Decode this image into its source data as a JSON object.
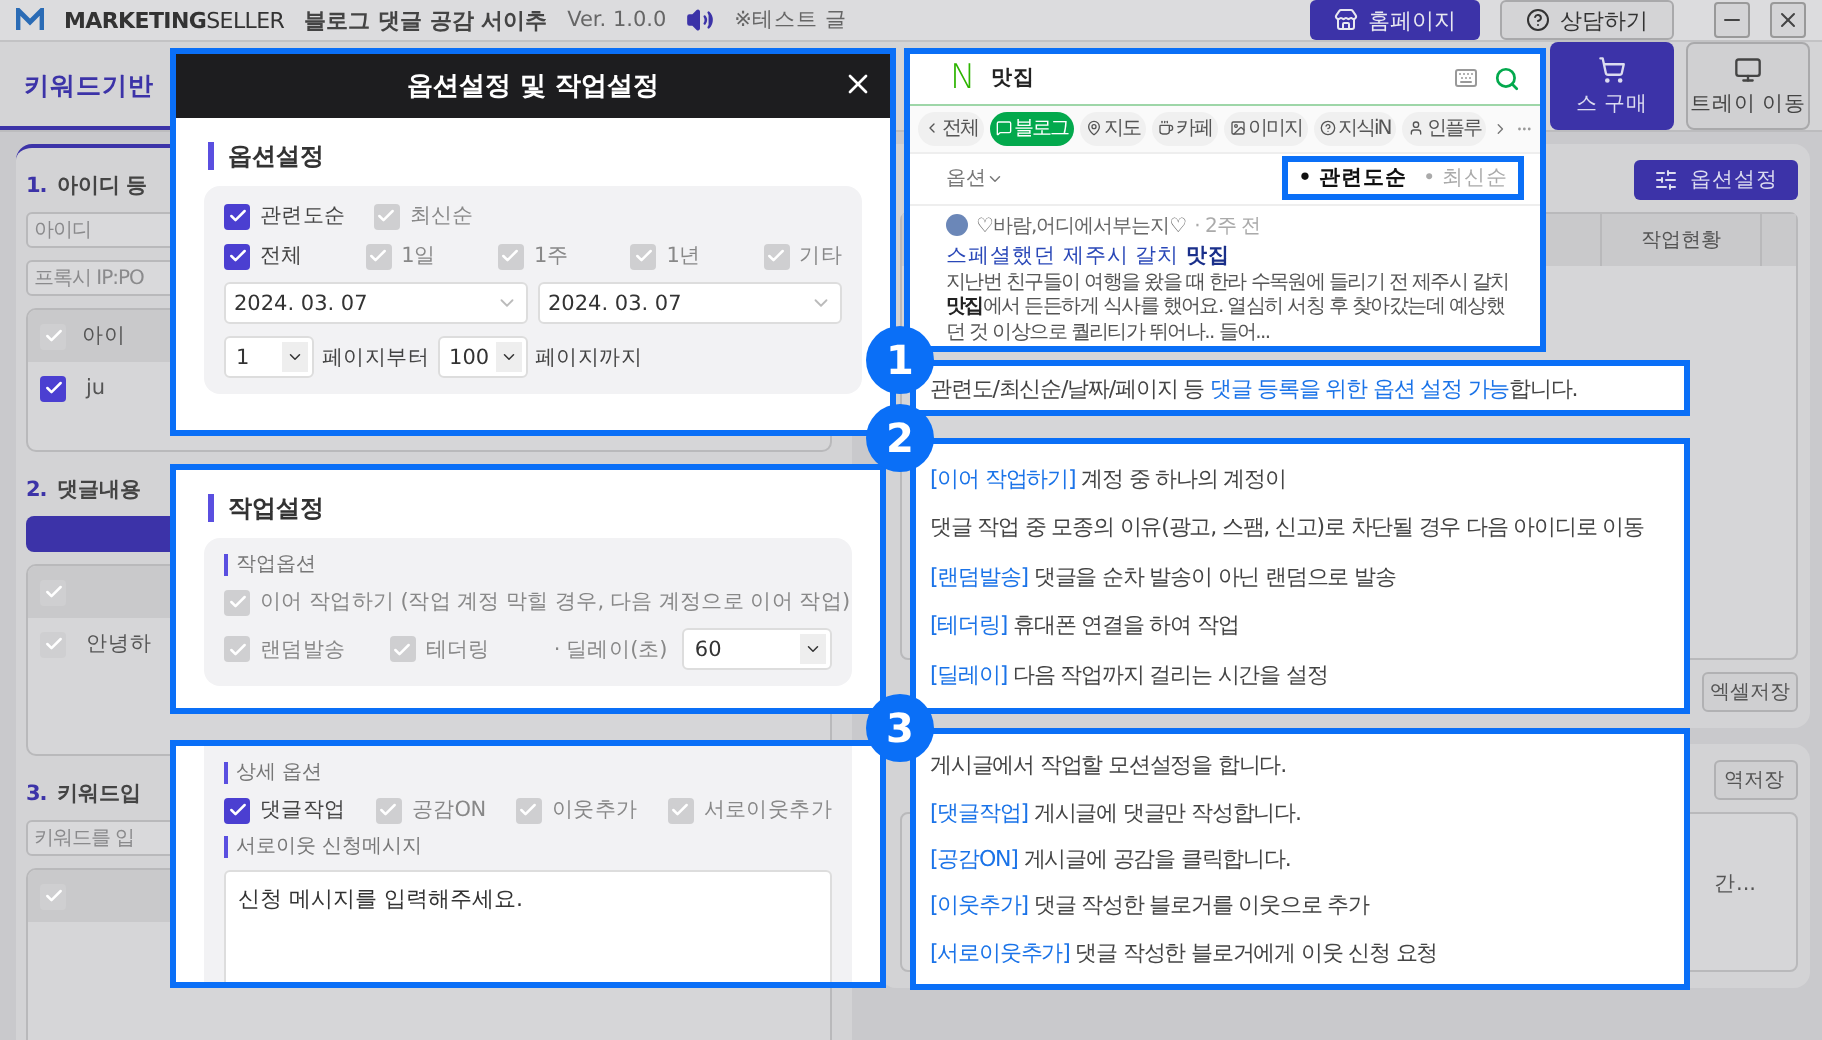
{
  "header": {
    "logo_bold": "MARKETING",
    "logo_light": "SELLER",
    "app_title": "블로그 댓글 공감 서이추",
    "version": "Ver. 1.0.0",
    "notice": "※테스트 글",
    "buttons": [
      {
        "label": "홈페이지",
        "kind": "primary"
      },
      {
        "label": "상담하기",
        "kind": "secondary"
      }
    ]
  },
  "tabs": [
    {
      "label": "키워드기반",
      "selected": true
    }
  ],
  "side_buttons": [
    {
      "label": "스 구매",
      "kind": "primary"
    },
    {
      "label": "트레이 이동",
      "kind": "secondary"
    }
  ],
  "left_sections": [
    {
      "number": "1.",
      "title": "아이디 등",
      "fields": [
        {
          "placeholder": "아이디"
        },
        {
          "placeholder": "프록시 IP:PO"
        }
      ],
      "action_bar": false,
      "table": {
        "header_checked": false,
        "column": "아이",
        "rows": [
          {
            "checked": true,
            "text": "ju"
          }
        ]
      }
    },
    {
      "number": "2.",
      "title": "댓글내용",
      "action_bar": true,
      "table": {
        "header_checked": false,
        "rows": [
          {
            "checked": false,
            "text": "안녕하"
          }
        ]
      }
    },
    {
      "number": "3.",
      "title": "키워드입",
      "fields": [
        {
          "placeholder": "키워드를 입"
        }
      ],
      "action_bar": false,
      "table": {
        "header_checked": false
      }
    }
  ],
  "right_panel": {
    "option_button": "옵션설정",
    "columns": [
      "작업현황"
    ],
    "excel_button": "엑셀저장",
    "save_button": "역저장",
    "list_item": "간..."
  },
  "modal": {
    "title": "옵션설정 및 작업설정",
    "option_section": {
      "title": "옵션설정",
      "sort": [
        {
          "label": "관련도순",
          "checked": true
        },
        {
          "label": "최신순",
          "checked": false
        }
      ],
      "period": [
        {
          "label": "전체",
          "checked": true
        },
        {
          "label": "1일",
          "checked": false
        },
        {
          "label": "1주",
          "checked": false
        },
        {
          "label": "1년",
          "checked": false
        },
        {
          "label": "기타",
          "checked": false
        }
      ],
      "dates": [
        "2024. 03. 07",
        "2024. 03. 07"
      ],
      "page_from": "1",
      "page_from_label": "페이지부터",
      "page_to": "100",
      "page_to_label": "페이지까지"
    },
    "work_section": {
      "title": "작업설정",
      "subtitle": "작업옵션",
      "continue": {
        "label": "이어 작업하기 (작업 계정 막힐 경우, 다음 계정으로 이어 작업)",
        "checked": false
      },
      "options": [
        {
          "label": "랜덤발송",
          "checked": false
        },
        {
          "label": "테더링",
          "checked": false
        }
      ],
      "delay_label": "· 딜레이(초)",
      "delay_value": "60"
    },
    "detail_section": {
      "subtitle": "상세 옵션",
      "options": [
        {
          "label": "댓글작업",
          "checked": true
        },
        {
          "label": "공감ON",
          "checked": false
        },
        {
          "label": "이웃추가",
          "checked": false
        },
        {
          "label": "서로이웃추가",
          "checked": false
        }
      ],
      "message_label": "서로이웃 신청메시지",
      "message_value": "신청 메시지를 입력해주세요."
    }
  },
  "search_preview": {
    "logo": "N",
    "query": "맛집",
    "chips": [
      {
        "label": "전체",
        "selected": false
      },
      {
        "label": "블로그",
        "selected": true
      },
      {
        "label": "지도",
        "selected": false
      },
      {
        "label": "카페",
        "selected": false
      },
      {
        "label": "이미지",
        "selected": false
      },
      {
        "label": "지식iN",
        "selected": false
      },
      {
        "label": "인플루",
        "selected": false
      }
    ],
    "filter_label": "옵션",
    "sort": [
      {
        "label": "• 관련도순",
        "selected": true
      },
      {
        "label": "• 최신순",
        "selected": false
      }
    ],
    "post": {
      "author": "♡바람,어디에서부는지♡",
      "time": "· 2주 전",
      "title": "스페셜했던 제주시 갈치 **맛집**",
      "snippet": "지난번 친구들이 여행을 왔을 때 한라 수목원에 들리기 전 제주시 갈치 **맛집**에서 든든하게 식사를 했어요. 열심히 서칭 후 찾아갔는데 예상했던 것 이상으로 퀄리티가 뛰어나.. 들어..."
    }
  },
  "callouts": [
    {
      "number": "1",
      "lines": [
        [
          {
            "text": "관련도/최신순/날짜/페이지 등 ",
            "emphasis": false
          },
          {
            "text": "댓글 등록을 위한 옵션 설정 가능",
            "emphasis": true
          },
          {
            "text": "합니다.",
            "emphasis": false
          }
        ]
      ]
    },
    {
      "number": "2",
      "lines": [
        [
          {
            "text": "[이어 작업하기]",
            "emphasis": true
          },
          {
            "text": " 계정 중 하나의 계정이",
            "emphasis": false
          }
        ],
        [
          {
            "text": "댓글 작업 중 모종의 이유(광고, 스팸, 신고)로 차단될 경우 다음 아이디로 이동",
            "emphasis": false
          }
        ],
        [
          {
            "text": "[랜덤발송]",
            "emphasis": true
          },
          {
            "text": " 댓글을 순차 발송이 아닌 랜덤으로 발송",
            "emphasis": false
          }
        ],
        [
          {
            "text": "[테더링]",
            "emphasis": true
          },
          {
            "text": " 휴대폰 연결을 하여 작업",
            "emphasis": false
          }
        ],
        [
          {
            "text": "[딜레이]",
            "emphasis": true
          },
          {
            "text": " 다음 작업까지 걸리는 시간을 설정",
            "emphasis": false
          }
        ]
      ]
    },
    {
      "number": "3",
      "lines": [
        [
          {
            "text": "게시글에서 작업할 모션설정을 합니다.",
            "emphasis": false
          }
        ],
        [
          {
            "text": "[댓글작업]",
            "emphasis": true
          },
          {
            "text": " 게시글에 댓글만 작성합니다.",
            "emphasis": false
          }
        ],
        [
          {
            "text": "[공감ON]",
            "emphasis": true
          },
          {
            "text": " 게시글에 공감을 클릭합니다.",
            "emphasis": false
          }
        ],
        [
          {
            "text": "[이웃추가]",
            "emphasis": true
          },
          {
            "text": " 댓글 작성한 블로거를 이웃으로 추가",
            "emphasis": false
          }
        ],
        [
          {
            "text": "[서로이웃추가]",
            "emphasis": true
          },
          {
            "text": " 댓글 작성한 블로거에게 이웃 신청 요청",
            "emphasis": false
          }
        ]
      ]
    }
  ]
}
